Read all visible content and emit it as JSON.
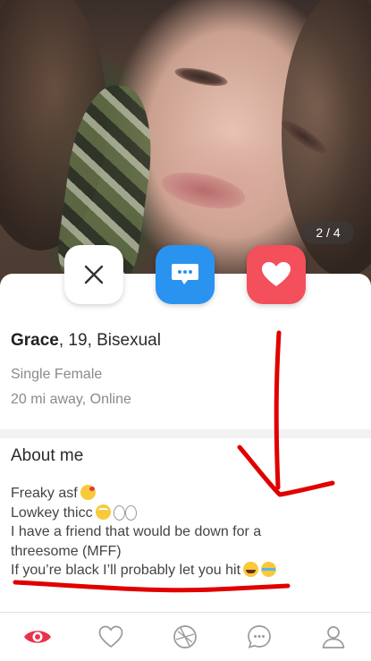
{
  "photo": {
    "counter": "2 / 4"
  },
  "actions": {
    "pass": "close-icon",
    "message": "chat-bubble-icon",
    "like": "heart-icon"
  },
  "profile": {
    "name": "Grace",
    "details": ", 19, Bisexual",
    "line1": "Single Female",
    "line2": "20 mi away, Online"
  },
  "about": {
    "title": "About me",
    "lines": [
      "Freaky asf",
      "Lowkey thicc",
      "I have a friend that would be down for a",
      "threesome (MFF)",
      "If you’re black I’ll probably let you hit"
    ]
  },
  "tabs": [
    {
      "icon": "eye-icon",
      "active": true
    },
    {
      "icon": "heart-outline-icon",
      "active": false
    },
    {
      "icon": "aperture-icon",
      "active": false
    },
    {
      "icon": "chat-icon",
      "active": false
    },
    {
      "icon": "profile-icon",
      "active": false
    }
  ],
  "colors": {
    "accent": "#e8334a",
    "message_button": "#2a93f0",
    "like_button": "#f3505c",
    "annotation": "#e00000"
  }
}
